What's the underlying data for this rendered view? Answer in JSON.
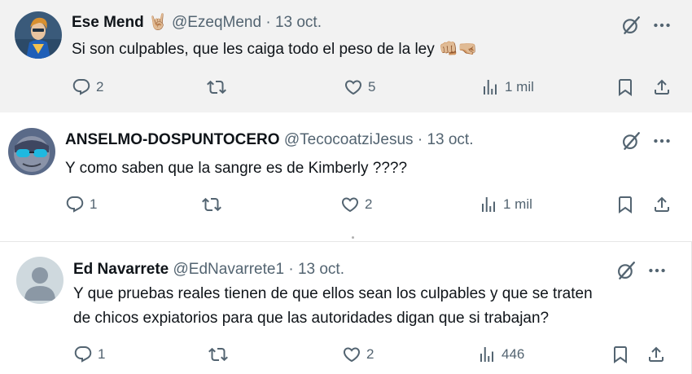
{
  "tweets": [
    {
      "name": "Ese Mend",
      "name_emoji": "🤘🏼",
      "handle": "@EzeqMend",
      "separator": "·",
      "date": "13 oct.",
      "text": "Si son culpables, que les caiga todo el peso de la ley",
      "text_emoji": "👊🏼🤜🏼",
      "replies": "2",
      "retweets": "",
      "likes": "5",
      "views": "1 mil"
    },
    {
      "name": "ANSELMO-DOSPUNTOCERO",
      "handle": "@TecocoatziJesus",
      "separator": "·",
      "date": "13 oct.",
      "text": "Y como saben que la sangre es de Kimberly ????",
      "replies": "1",
      "retweets": "",
      "likes": "2",
      "views": "1 mil"
    },
    {
      "name": "Ed Navarrete",
      "handle": "@EdNavarrete1",
      "separator": "·",
      "date": "13 oct.",
      "text_line1": "Y que pruebas reales tienen de que ellos sean los culpables y que se traten",
      "text_line2": "de chicos expiatorios para que las autoridades digan que si trabajan?",
      "replies": "1",
      "retweets": "",
      "likes": "2",
      "views": "446"
    }
  ],
  "icons": {
    "reply": "reply-icon",
    "retweet": "retweet-icon",
    "like": "heart-icon",
    "views": "views-icon",
    "bookmark": "bookmark-icon",
    "share": "share-icon",
    "grok": "grok-icon",
    "more": "more-icon"
  },
  "colors": {
    "text": "#0f1419",
    "secondary": "#536471",
    "hover_background": "#f2f2f2"
  }
}
